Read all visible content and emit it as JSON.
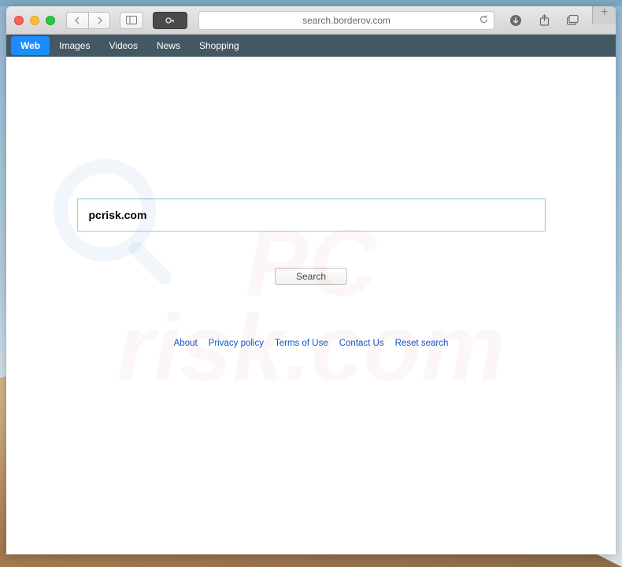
{
  "browser": {
    "address_url": "search.borderov.com"
  },
  "search_nav": {
    "items": [
      {
        "label": "Web",
        "active": true
      },
      {
        "label": "Images",
        "active": false
      },
      {
        "label": "Videos",
        "active": false
      },
      {
        "label": "News",
        "active": false
      },
      {
        "label": "Shopping",
        "active": false
      }
    ]
  },
  "search": {
    "input_value": "pcrisk.com",
    "button_label": "Search"
  },
  "footer": {
    "links": [
      "About",
      "Privacy policy",
      "Terms of Use",
      "Contact Us",
      "Reset search"
    ]
  },
  "watermark": {
    "line1": "PC",
    "line2": "risk.com"
  }
}
